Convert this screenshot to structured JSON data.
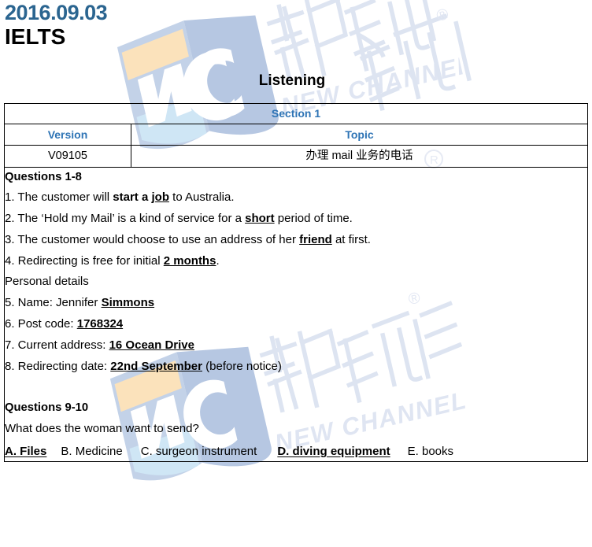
{
  "header": {
    "date": "2016.09.03",
    "date_color": "#2b6590",
    "exam": "IELTS"
  },
  "section_title": "Listening",
  "table": {
    "section_label": "Section 1",
    "section_color": "#2e74b5",
    "columns": [
      "Version",
      "Topic"
    ],
    "row": {
      "version": "V09105",
      "topic": "办理 mail 业务的电话"
    }
  },
  "questions_1_8": {
    "heading": "Questions 1-8",
    "items": [
      {
        "num": "1.",
        "pre": " The customer will ",
        "semi": "start a ",
        "answer": "job",
        "post": " to Australia."
      },
      {
        "num": "2.",
        "pre": " The ‘Hold my Mail’ is a kind of service for a ",
        "semi": "",
        "answer": "short",
        "post": " period of time."
      },
      {
        "num": "3.",
        "pre": " The customer would choose to use an address of her ",
        "semi": "",
        "answer": "friend",
        "post": " at first."
      },
      {
        "num": "4.",
        "pre": " Redirecting is free for initial ",
        "semi": "",
        "answer": "2 months",
        "post": "."
      }
    ],
    "personal_details_label": "Personal details",
    "details": [
      {
        "num": "5.",
        "pre": " Name: Jennifer ",
        "answer": "Simmons",
        "post": ""
      },
      {
        "num": "6.",
        "pre": " Post code: ",
        "answer": "1768324",
        "post": ""
      },
      {
        "num": "7.",
        "pre": " Current address: ",
        "answer": "16 Ocean Drive",
        "post": ""
      },
      {
        "num": "8.",
        "pre": " Redirecting date: ",
        "answer": "22nd September",
        "post": " (before notice)"
      }
    ]
  },
  "questions_9_10": {
    "heading": "Questions 9-10",
    "prompt": "What does the woman want to send?",
    "options": [
      {
        "label": "A. Files",
        "correct": true
      },
      {
        "label": "B. Medicine",
        "correct": false
      },
      {
        "label": "C. surgeon instrument",
        "correct": false
      },
      {
        "label": "D. diving equipment",
        "correct": true
      },
      {
        "label": "E. books",
        "correct": false
      }
    ]
  },
  "watermark": {
    "brand_cn": "新航道",
    "brand_en": "NEW CHANNEL",
    "monogram": "NC",
    "registered": "®",
    "shield_blue": "#c7d4ea",
    "shield_blue_dark": "#b3c4e0",
    "shield_orange": "#fbe2bb",
    "shield_cyan": "#cfe6f5",
    "text_color": "#dfe5f2"
  }
}
